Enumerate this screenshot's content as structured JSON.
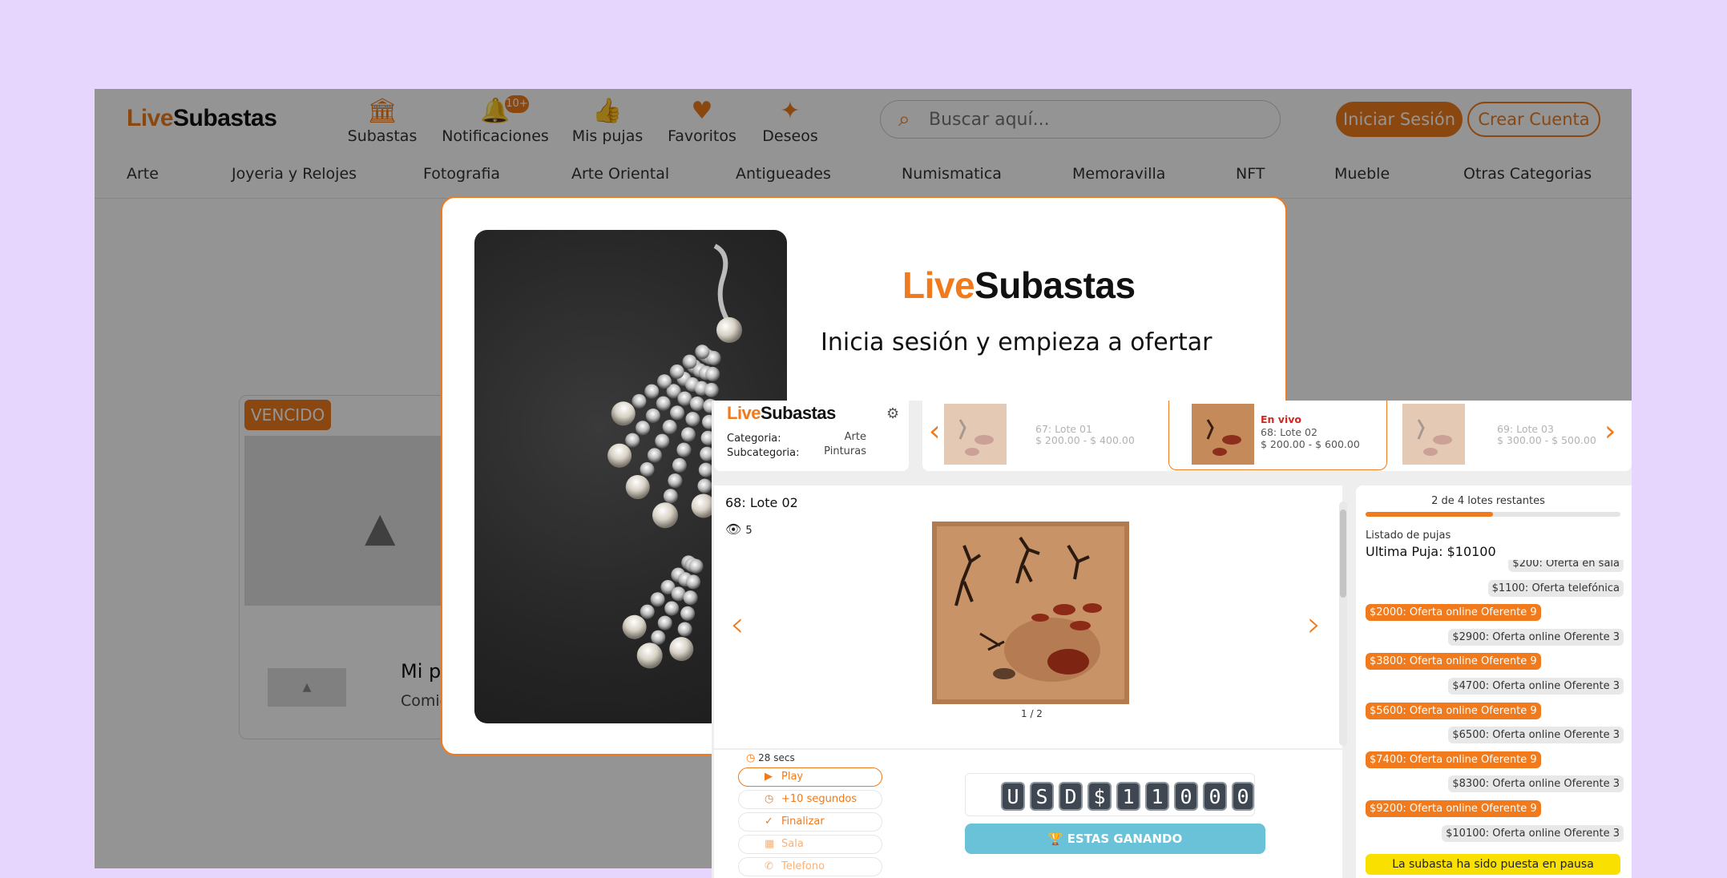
{
  "site": {
    "logo_live": "Live",
    "logo_subastas": "Subastas",
    "nav": [
      {
        "label": "Subastas",
        "icon": "bank-icon"
      },
      {
        "label": "Notificaciones",
        "icon": "bell-icon",
        "badge": "10+"
      },
      {
        "label": "Mis pujas",
        "icon": "thumbs-up-icon"
      },
      {
        "label": "Favoritos",
        "icon": "heart-icon"
      },
      {
        "label": "Deseos",
        "icon": "sparkles-icon"
      }
    ],
    "search_placeholder": "Buscar aquí...",
    "login_label": "Iniciar Sesión",
    "register_label": "Crear Cuenta",
    "categories": [
      "Arte",
      "Joyeria y Relojes",
      "Fotografia",
      "Arte Oriental",
      "Antigueades",
      "Numismatica",
      "Memoravilla",
      "NFT",
      "Mueble",
      "Otras Categorias"
    ],
    "card": {
      "badge": "VENCIDO",
      "title": "Mi pr",
      "subtitle": "Comie"
    }
  },
  "modal": {
    "logo_live": "Live",
    "logo_subastas": "Subastas",
    "tagline": "Inicia sesión y empieza a ofertar"
  },
  "live": {
    "logo_live": "Live",
    "logo_subastas": "Subastas",
    "category_label": "Categoria:",
    "category_value": "Arte",
    "subcategory_label": "Subcategoria:",
    "subcategory_value": "Pinturas",
    "lots": [
      {
        "name": "67: Lote 01",
        "range": "$ 200.00 - $ 400.00",
        "status": ""
      },
      {
        "name": "68: Lote 02",
        "range": "$ 200.00 - $ 600.00",
        "status": "En vivo"
      },
      {
        "name": "69: Lote 03",
        "range": "$ 300.00 - $ 500.00",
        "status": ""
      }
    ],
    "current_lot_title": "68: Lote 02",
    "views": "5",
    "image_counter": "1 / 2",
    "timer": "28 secs",
    "controls": [
      {
        "label": "Play",
        "icon": "play-icon"
      },
      {
        "label": "+10 segundos",
        "icon": "clock-icon"
      },
      {
        "label": "Finalizar",
        "icon": "check-circle-icon"
      },
      {
        "label": "Sala",
        "icon": "room-icon"
      },
      {
        "label": "Telefono",
        "icon": "phone-icon"
      }
    ],
    "amount_chars": [
      "U",
      "S",
      "D",
      "$",
      "1",
      "1",
      "0",
      "0",
      "0"
    ],
    "winning_label": "ESTAS GANANDO",
    "lots_remaining": "2 de 4 lotes restantes",
    "lots_progress": 0.5,
    "bids_title": "Listado de pujas",
    "last_bid": "Ultima Puja: $10100",
    "bids": [
      {
        "text": "$200: Oferta en sala",
        "mine": false
      },
      {
        "text": "$1100: Oferta telefónica",
        "mine": false
      },
      {
        "text": "$2000: Oferta online Oferente 9",
        "mine": true
      },
      {
        "text": "$2900: Oferta online Oferente 3",
        "mine": false
      },
      {
        "text": "$3800: Oferta online Oferente 9",
        "mine": true
      },
      {
        "text": "$4700: Oferta online Oferente 3",
        "mine": false
      },
      {
        "text": "$5600: Oferta online Oferente 9",
        "mine": true
      },
      {
        "text": "$6500: Oferta online Oferente 3",
        "mine": false
      },
      {
        "text": "$7400: Oferta online Oferente 9",
        "mine": true
      },
      {
        "text": "$8300: Oferta online Oferente 3",
        "mine": false
      },
      {
        "text": "$9200: Oferta online Oferente 9",
        "mine": true
      },
      {
        "text": "$10100: Oferta online Oferente 3",
        "mine": false
      }
    ],
    "pause_message": "La subasta ha sido puesta en pausa"
  },
  "colors": {
    "accent": "#f07a1c",
    "background": "#e6d5fd",
    "winning": "#69c2d8",
    "pause": "#f9e000"
  }
}
